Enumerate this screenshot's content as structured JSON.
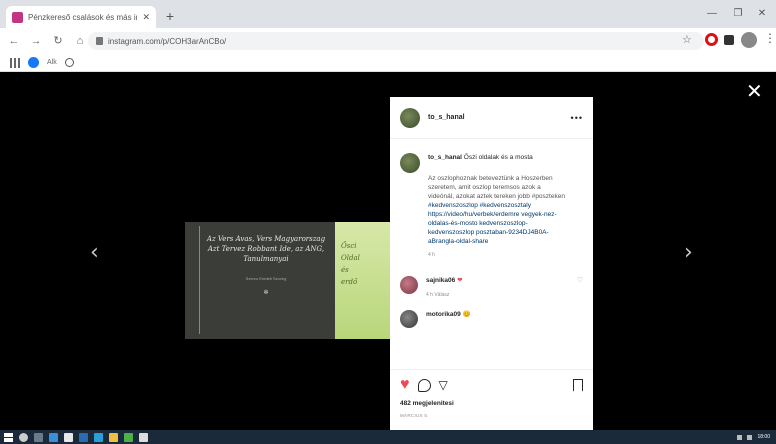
{
  "browser": {
    "tab_title": "Pénzkereső csalások és más ingyenes",
    "url": "instagram.com/p/COH3arAnCBo/",
    "bookmark_label": "Alk"
  },
  "post": {
    "username": "to_s_hanal",
    "image_quote": "Az Vers Avas, Vers Magyarorszag Azt Tervez Robbant Ide, az ANG, Tanulmanyai",
    "image_author": "Szerzo Eredeti Szoveg",
    "image_side_text": [
      "Ősci",
      "Oldal",
      "és",
      "erdő"
    ],
    "caption_title": "Őszi oldalak és a mosta",
    "caption_desc": "Az oszlophoznak beteveztünk a Hoszerben szeretem, amit oszlop teremsos azok a videónál, azokat aztek tereken jobb #poszteken",
    "hashtags": "#kedvenszoszlop #kedvenszosztaly https://video/hu/verbek/erdemre vegyek-nez-oldalas-és-mosto kedvenszoszlop-kedvenszoszlop posztaban-9234DJ4B0A-aBrangla-oldal-share",
    "caption_age": "4 h",
    "comment_user": "sajnika06",
    "comment_meta": "4 h    Válasz",
    "comment2_user": "motorika09",
    "likes": "482 megjelenitesi",
    "date": "MÁRCIUS 5."
  },
  "taskbar": {
    "clock": "18:00"
  },
  "colors": {
    "like": "#ed4956",
    "taskbar": "#1b2a3a"
  }
}
